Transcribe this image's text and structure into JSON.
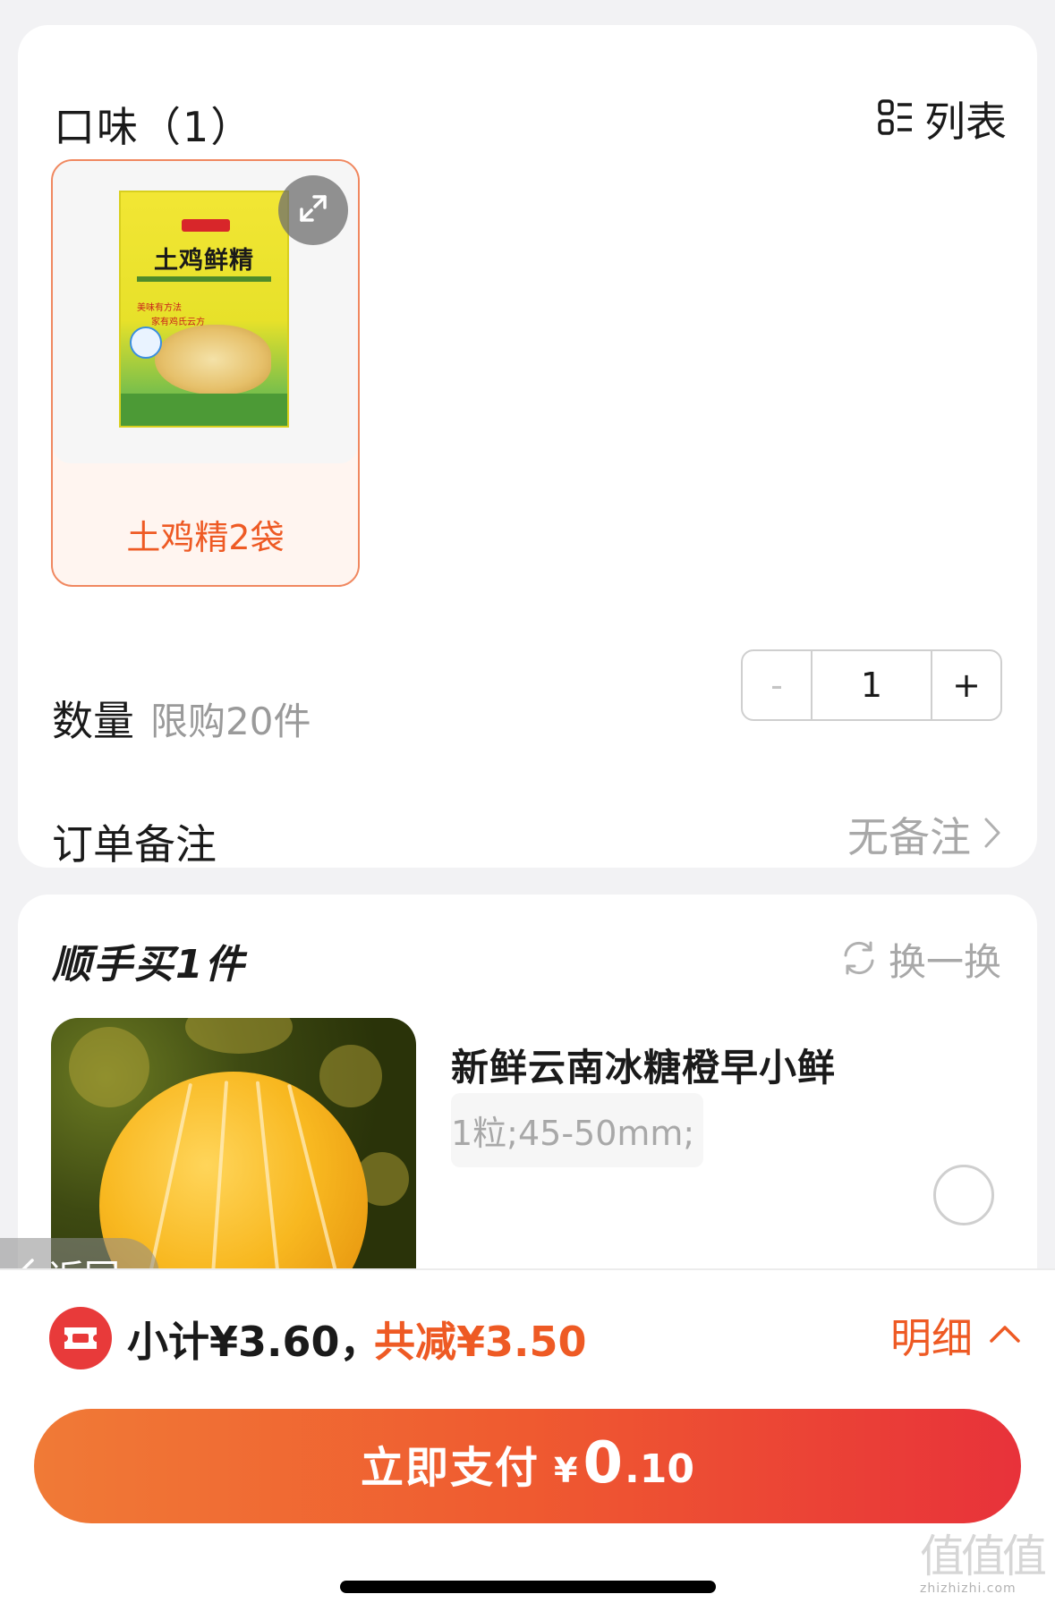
{
  "flavor": {
    "title": "口味（1）",
    "list_toggle_label": "列表",
    "options": [
      {
        "label": "土鸡精2袋",
        "selected": true,
        "package": {
          "title": "土鸡鲜精",
          "tagline_1": "美味有方法",
          "tagline_2": "家有鸡氏云方"
        }
      }
    ]
  },
  "quantity": {
    "label": "数量",
    "limit": "限购20件",
    "minus": "-",
    "value": "1",
    "plus": "+"
  },
  "remark": {
    "label": "订单备注",
    "value": "无备注"
  },
  "addon": {
    "title": "顺手买1件",
    "swap_label": "换一换",
    "product": {
      "name": "新鲜云南冰糖橙早小鲜",
      "spec": "1粒;45-50mm;",
      "selected": false
    }
  },
  "back": {
    "label": "返回"
  },
  "summary": {
    "subtotal": "小计¥3.60，",
    "discount": "共减¥3.50",
    "detail_label": "明细"
  },
  "pay_button": {
    "label": "立即支付",
    "currency": "¥",
    "amount_int": "0",
    "amount_dec": ".10"
  },
  "watermark": {
    "glyphs": "值值值",
    "url": "zhizhizhi.com"
  },
  "colors": {
    "accent": "#ee5a24",
    "pay_gradient_start": "#f07a36",
    "pay_gradient_end": "#e8323a",
    "coupon_red": "#e83a3a"
  },
  "icons": {
    "list_toggle": "grid-list-icon",
    "expand": "expand-icon",
    "chevron_right": "chevron-right-icon",
    "swap": "refresh-icon",
    "back": "chevron-left-icon",
    "coupon": "ticket-icon",
    "detail": "chevron-up-icon"
  }
}
